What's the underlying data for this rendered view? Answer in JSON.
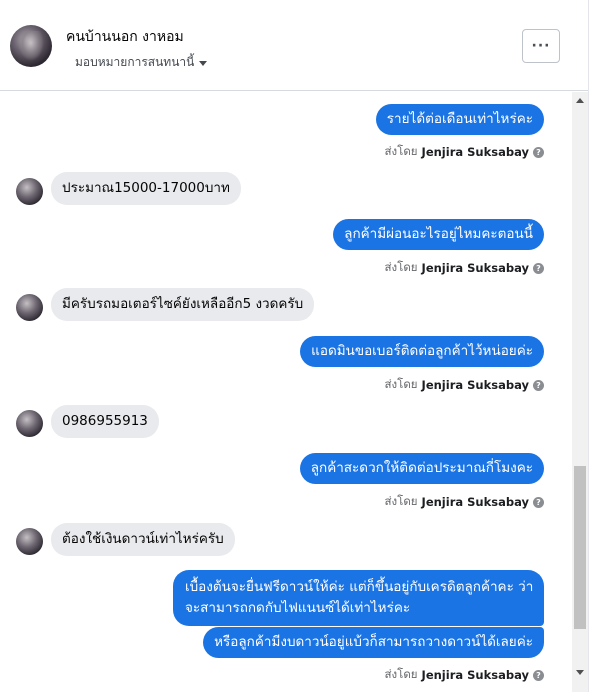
{
  "header": {
    "contact_name": "คนบ้านนอก งาหอม",
    "assign_label": "มอบหมายการสนทนานี้",
    "more_label": "···"
  },
  "messages": [
    {
      "direction": "out",
      "text": "รายได้ต่อเดือนเท่าไหร่คะ",
      "sent_by_prefix": "ส่งโดย",
      "sender": "Jenjira Suksabay"
    },
    {
      "direction": "in",
      "text": "ประมาณ15000-17000บาท"
    },
    {
      "direction": "out",
      "text": "ลูกค้ามีผ่อนอะไรอยู่ไหมคะตอนนี้",
      "sent_by_prefix": "ส่งโดย",
      "sender": "Jenjira Suksabay"
    },
    {
      "direction": "in",
      "text": "มีครับรถมอเตอร์ไซค์ยังเหลืออีก5 งวดครับ"
    },
    {
      "direction": "out",
      "text": "แอดมินขอเบอร์ติดต่อลูกค้าไว้หน่อยค่ะ",
      "sent_by_prefix": "ส่งโดย",
      "sender": "Jenjira Suksabay"
    },
    {
      "direction": "in",
      "text": "0986955913"
    },
    {
      "direction": "out",
      "text": "ลูกค้าสะดวกให้ติดต่อประมาณกี่โมงคะ",
      "sent_by_prefix": "ส่งโดย",
      "sender": "Jenjira Suksabay"
    },
    {
      "direction": "in",
      "text": "ต้องใช้เงินดาวน์เท่าไหร่ครับ"
    },
    {
      "direction": "out",
      "lines": [
        "เบื้องต้นจะยื่นฟรีดาวน์ให้ค่ะ แต่ก็ขึ้นอยู่กับเครดิตลูกค้าคะ ว่า",
        "จะสามารถกดกับไฟแนนซ์ได้เท่าไหร่คะ"
      ]
    },
    {
      "direction": "out",
      "text": "หรือลูกค้ามีงบดาวน์อยู่แบ้วก็สามารถวางดาวน์ได้เลยค่ะ",
      "sent_by_prefix": "ส่งโดย",
      "sender": "Jenjira Suksabay"
    }
  ],
  "help_icon": "?"
}
